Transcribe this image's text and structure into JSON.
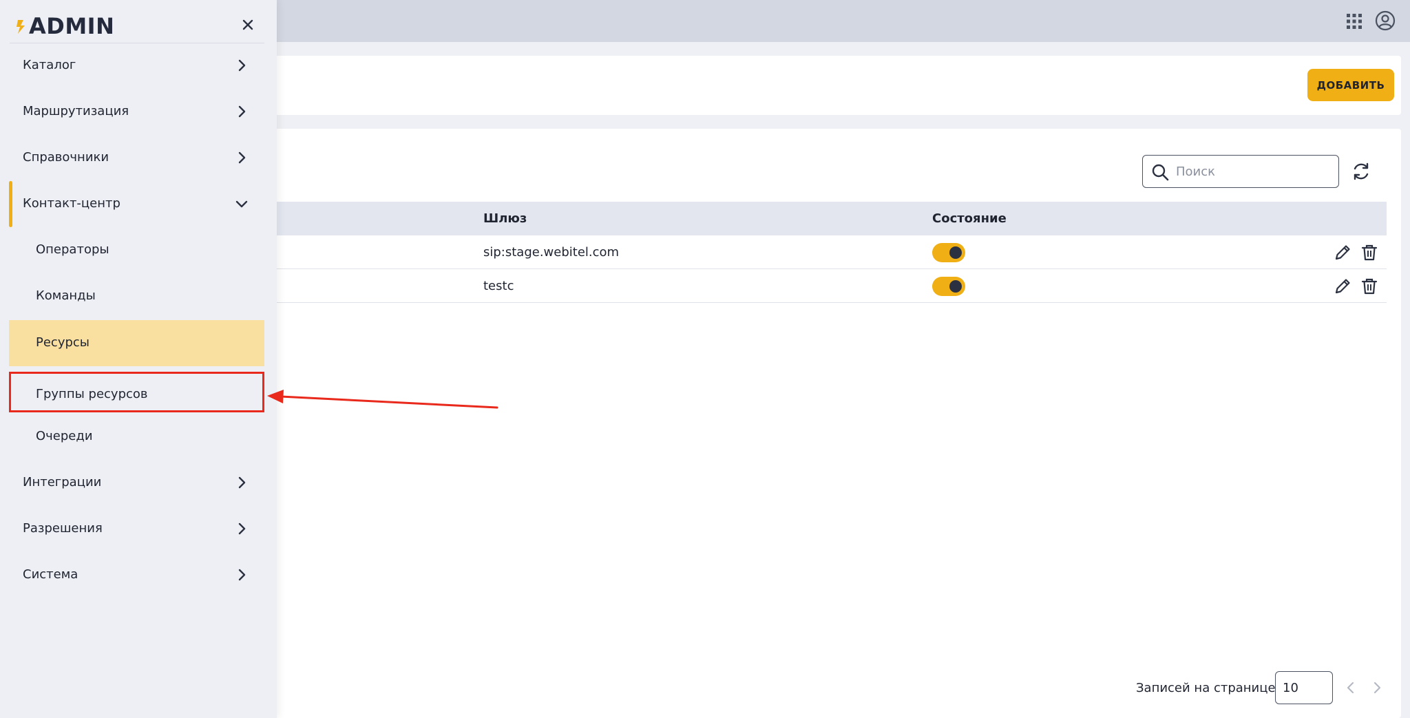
{
  "sidebar": {
    "logo_text": "ADMIN",
    "items": [
      {
        "label": "Каталог",
        "icon": "chevron-right-icon"
      },
      {
        "label": "Маршрутизация",
        "icon": "chevron-right-icon"
      },
      {
        "label": "Справочники",
        "icon": "chevron-right-icon"
      },
      {
        "label": "Контакт-центр",
        "icon": "chevron-down-icon"
      },
      {
        "label": "Операторы"
      },
      {
        "label": "Команды"
      },
      {
        "label": "Ресурсы"
      },
      {
        "label": "Группы ресурсов"
      },
      {
        "label": "Очереди"
      },
      {
        "label": "Интеграции",
        "icon": "chevron-right-icon"
      },
      {
        "label": "Разрешения",
        "icon": "chevron-right-icon"
      },
      {
        "label": "Система",
        "icon": "chevron-right-icon"
      }
    ]
  },
  "header": {
    "add_label": "ДОБАВИТЬ"
  },
  "search": {
    "placeholder": "Поиск"
  },
  "table": {
    "columns": {
      "gateway": "Шлюз",
      "state": "Состояние"
    },
    "rows": [
      {
        "gateway": "sip:stage.webitel.com",
        "state_on": true
      },
      {
        "gateway": "testc",
        "state_on": true
      }
    ]
  },
  "pager": {
    "label": "Записей на странице:",
    "per_page": "10"
  },
  "colors": {
    "accent": "#f0b015",
    "selected_bg": "#f9e0a0",
    "annotation_red": "#e8291c"
  }
}
